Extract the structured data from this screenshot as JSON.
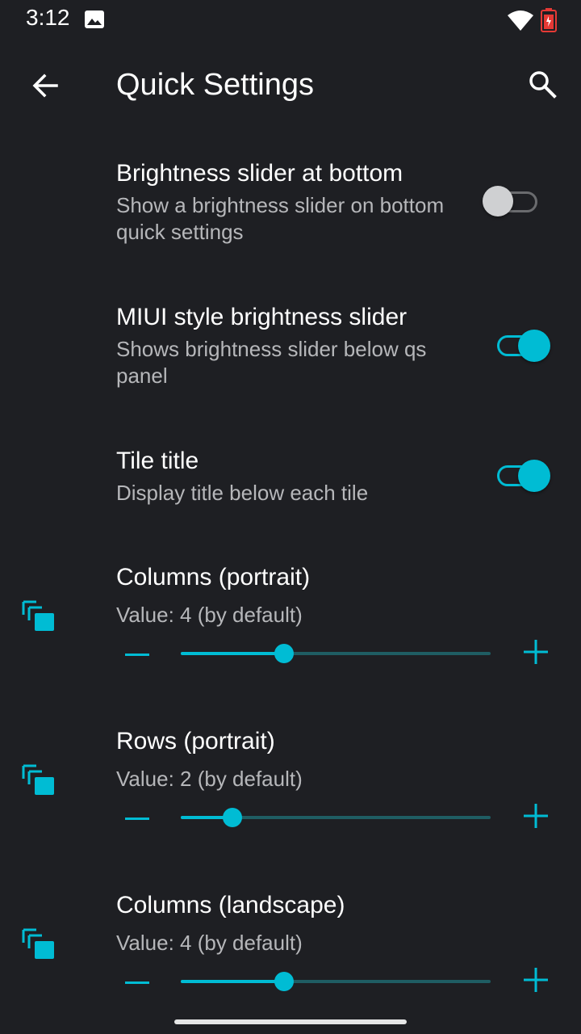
{
  "status_bar": {
    "time": "3:12",
    "icons": [
      "gallery-icon",
      "wifi-icon",
      "battery-icon"
    ]
  },
  "app_bar": {
    "title": "Quick Settings",
    "back_icon": "arrow-back-icon",
    "search_icon": "search-icon"
  },
  "colors": {
    "background": "#1e1f23",
    "accent": "#00bcd4",
    "summary_text": "#b6b7ba",
    "switch_off": "#cfd0d2"
  },
  "preferences": [
    {
      "title": "Brightness slider at bottom",
      "summary": "Show a brightness slider on bottom quick settings",
      "enabled": false
    },
    {
      "title": "MIUI style brightness slider",
      "summary": "Shows brightness slider below qs panel",
      "enabled": true
    },
    {
      "title": "Tile title",
      "summary": "Display title below each tile",
      "enabled": true
    }
  ],
  "sliders": [
    {
      "title": "Columns (portrait)",
      "value_text": "Value: 4  (by default)",
      "level": 0.333,
      "icon": "tiles-icon"
    },
    {
      "title": "Rows (portrait)",
      "value_text": "Value: 2  (by default)",
      "level": 0.167,
      "icon": "tiles-icon"
    },
    {
      "title": "Columns (landscape)",
      "value_text": "Value: 4  (by default)",
      "level": 0.333,
      "icon": "tiles-icon"
    }
  ]
}
